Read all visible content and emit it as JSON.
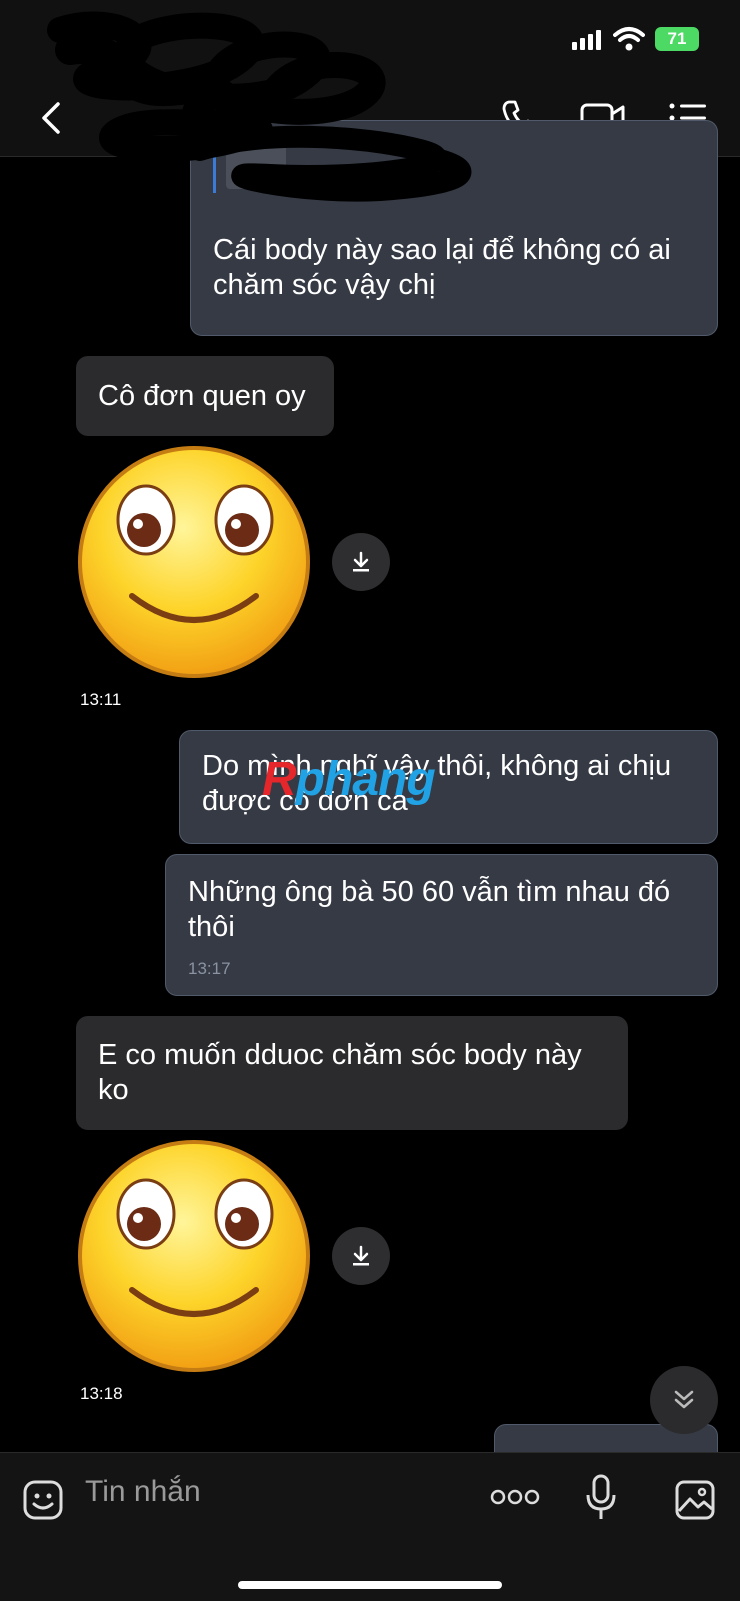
{
  "status_bar": {
    "battery": "71"
  },
  "messages": {
    "m1": {
      "line1": "Cái body này sao lại để không có ai",
      "line2": "chăm sóc vậy chị"
    },
    "m2": {
      "text": "Cô đơn quen oy"
    },
    "m2_time": "13:11",
    "m3": {
      "line1": "Do mình nghĩ vậy thôi, không ai chịu",
      "line2": "được cô đơn cả"
    },
    "m4": {
      "line1": "Những ông bà 50 60 vẫn tìm nhau đó",
      "line2": "thôi",
      "time": "13:17"
    },
    "m5": {
      "line1": "E co muốn dduoc chăm sóc body này",
      "line2": "ko"
    },
    "m5_time": "13:18"
  },
  "watermark": {
    "part1": "R",
    "part2": "phang"
  },
  "input": {
    "placeholder": "Tin nhắn"
  },
  "colors": {
    "sent_bubble": "#353a45",
    "received_bubble": "#2b2b2d",
    "battery": "#4cd964",
    "quote_bar": "#3a7bd5"
  },
  "icons": [
    "back-icon",
    "phone-icon",
    "video-icon",
    "menu-icon",
    "download-icon",
    "chevron-double-down-icon",
    "sticker-icon",
    "more-icon",
    "mic-icon",
    "image-icon"
  ]
}
